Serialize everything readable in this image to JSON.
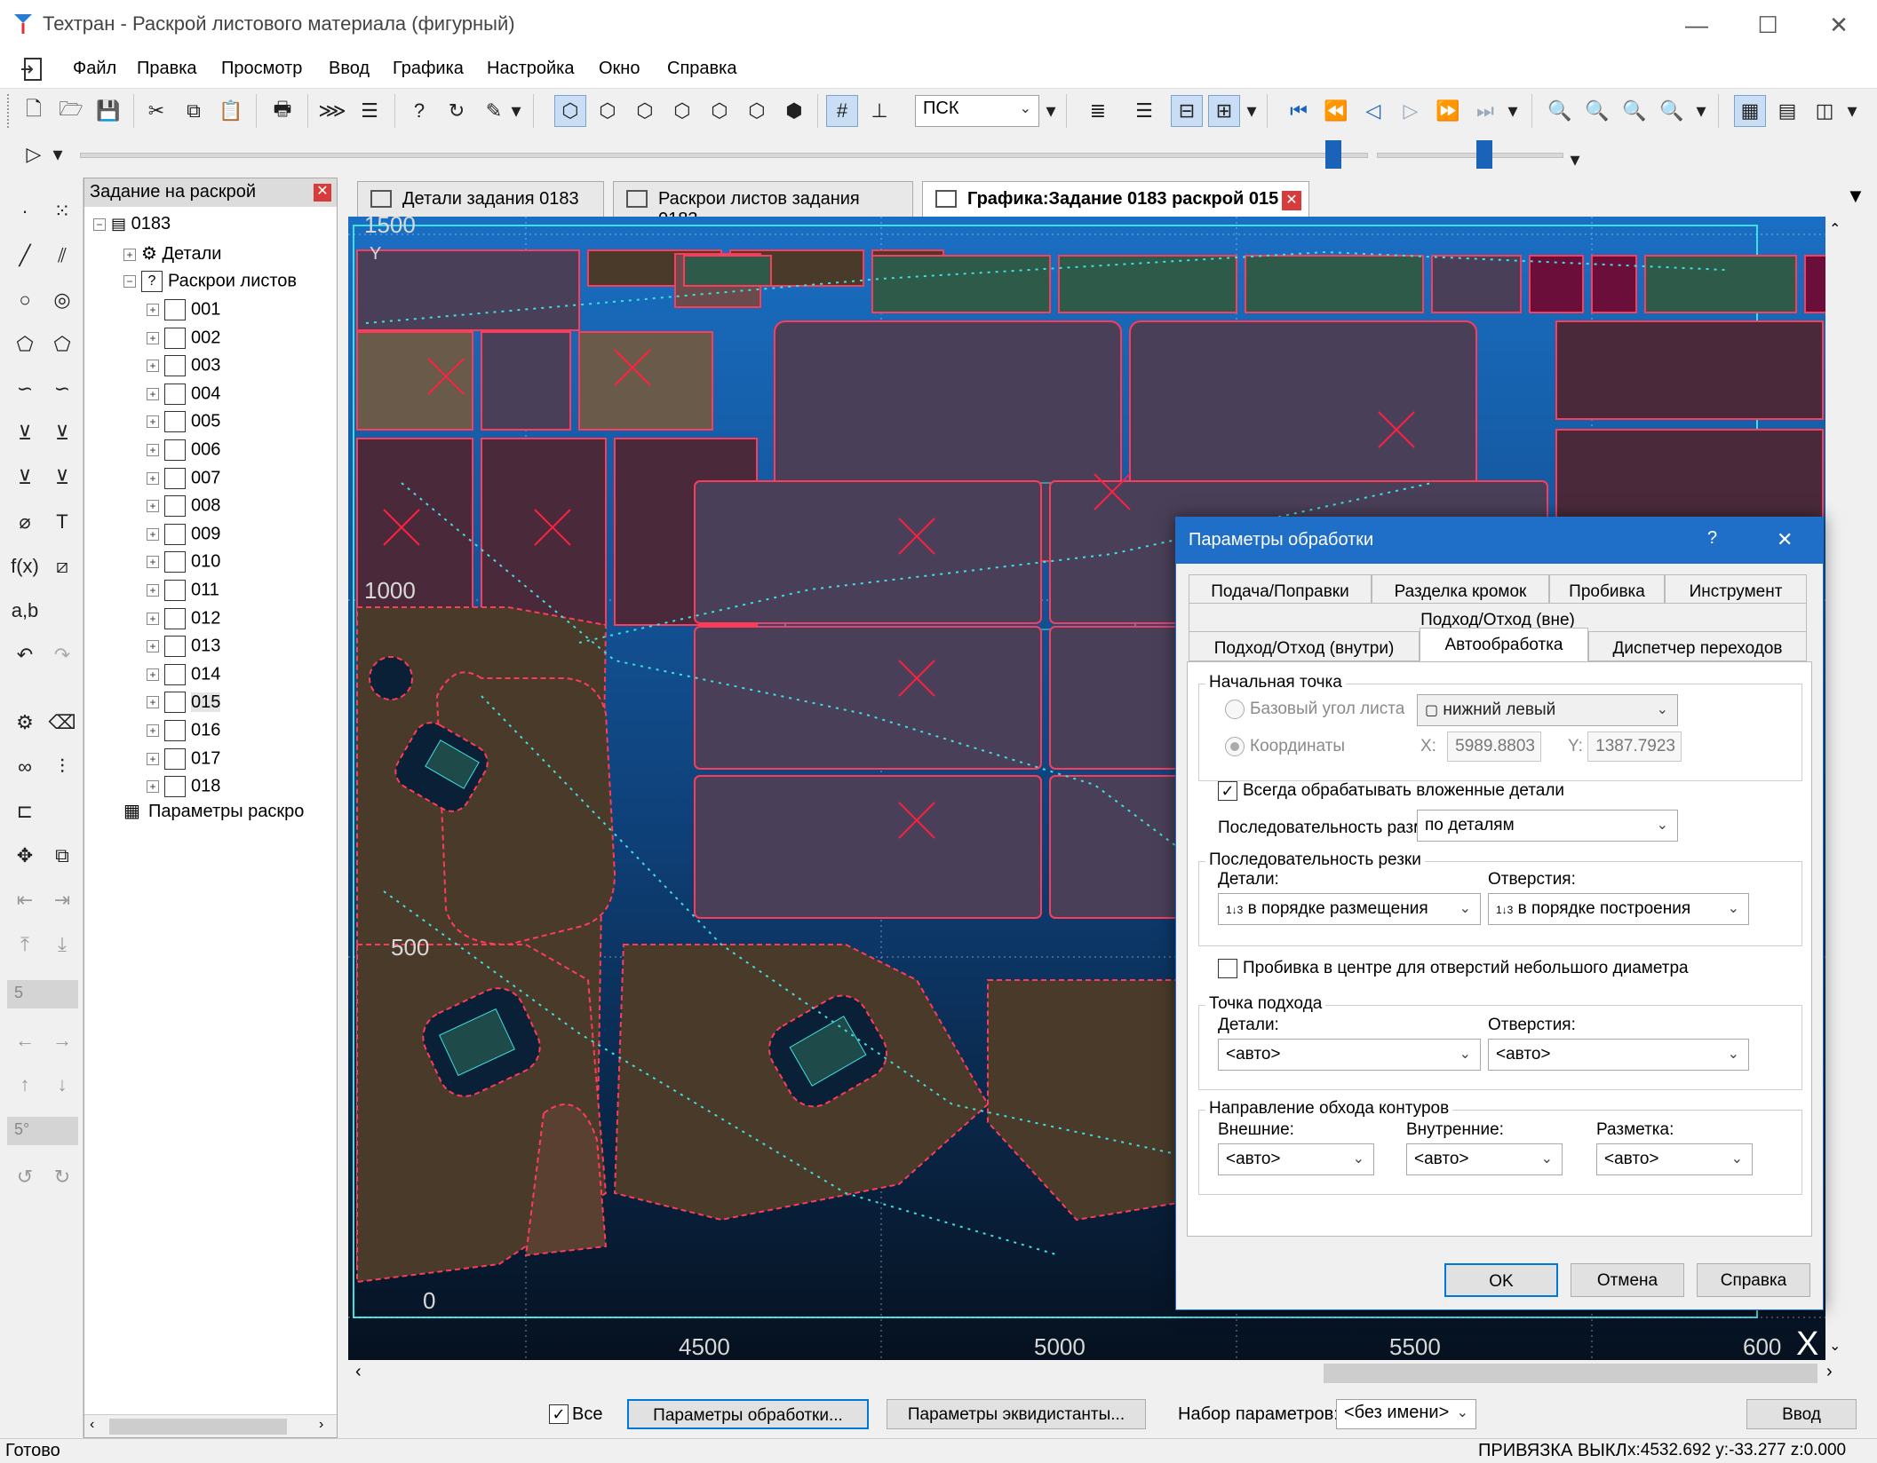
{
  "window": {
    "title": "Техтран - Раскрой листового материала (фигурный)",
    "minimize": "—",
    "maximize": "☐",
    "close": "✕"
  },
  "menu": [
    "Файл",
    "Правка",
    "Просмотр",
    "Ввод",
    "Графика",
    "Настройка",
    "Окно",
    "Справка"
  ],
  "toolbar": {
    "coord_system": "ПСК"
  },
  "tree": {
    "header": "Задание на раскрой",
    "root": "0183",
    "details": "Детали",
    "sheets": "Раскрои листов",
    "items": [
      "001",
      "002",
      "003",
      "004",
      "005",
      "006",
      "007",
      "008",
      "009",
      "010",
      "011",
      "012",
      "013",
      "014",
      "015",
      "016",
      "017",
      "018"
    ],
    "selected": "015",
    "params": "Параметры раскро"
  },
  "tabs": [
    {
      "label": "Детали задания 0183",
      "active": false
    },
    {
      "label": "Раскрои листов задания 0183",
      "active": false
    },
    {
      "label": "Графика:Задание 0183 раскрой 015",
      "active": true
    }
  ],
  "canvas": {
    "y_labels": [
      "1500",
      "1000",
      "500",
      "0"
    ],
    "x_labels": [
      "4500",
      "5000",
      "5500",
      "600"
    ],
    "axis_y_label": "Y",
    "axis_x_label": "X",
    "colors": {
      "background_top": "#1a6fc4",
      "background_bottom": "#06111f",
      "part_brown": "#4a3a2a",
      "part_purple": "#4a3f58",
      "part_green": "#2e5a4a",
      "part_magenta": "#6b0f3a",
      "contour": "#ff3b5a",
      "cut_lines": "#3fe0e0"
    }
  },
  "dialog": {
    "title": "Параметры обработки",
    "help_btn": "?",
    "close_btn": "✕",
    "tabs_row1": [
      "Подача/Поправки",
      "Разделка кромок",
      "Пробивка",
      "Инструмент"
    ],
    "tabs_row2": [
      "Подход/Отход (вне)"
    ],
    "tabs_row3": [
      "Подход/Отход (внутри)",
      "Автообработка",
      "Диспетчер переходов"
    ],
    "active_tab": "Автообработка",
    "start_point": {
      "group": "Начальная точка",
      "radio_corner": "Базовый угол листа",
      "corner_value": "нижний левый",
      "radio_coords": "Координаты",
      "x_label": "X:",
      "x_value": "5989.8803",
      "y_label": "Y:",
      "y_value": "1387.7923"
    },
    "always_nested": "Всегда обрабатывать вложенные детали",
    "marking_seq_label": "Последовательность разметки:",
    "marking_seq_value": "по деталям",
    "cut_seq": {
      "group": "Последовательность резки",
      "details_label": "Детали:",
      "details_value": "в порядке размещения",
      "holes_label": "Отверстия:",
      "holes_value": "в порядке построения"
    },
    "pierce_center": "Пробивка в центре для отверстий небольшого диаметра",
    "approach": {
      "group": "Точка подхода",
      "details_label": "Детали:",
      "details_value": "<авто>",
      "holes_label": "Отверстия:",
      "holes_value": "<авто>"
    },
    "direction": {
      "group": "Направление обхода контуров",
      "outer_label": "Внешние:",
      "outer_value": "<авто>",
      "inner_label": "Внутренние:",
      "inner_value": "<авто>",
      "marking_label": "Разметка:",
      "marking_value": "<авто>"
    },
    "ok": "OK",
    "cancel": "Отмена",
    "help": "Справка"
  },
  "params_bar": {
    "all_label": "Все",
    "proc_params": "Параметры обработки...",
    "equid_params": "Параметры эквидистанты...",
    "set_label": "Набор параметров:",
    "set_value": "<без имени>",
    "enter": "Ввод"
  },
  "status": {
    "ready": "Готово",
    "snap": "ПРИВЯЗКА ВЫКЛ",
    "coords": "x:4532.692 y:-33.277 z:0.000"
  }
}
